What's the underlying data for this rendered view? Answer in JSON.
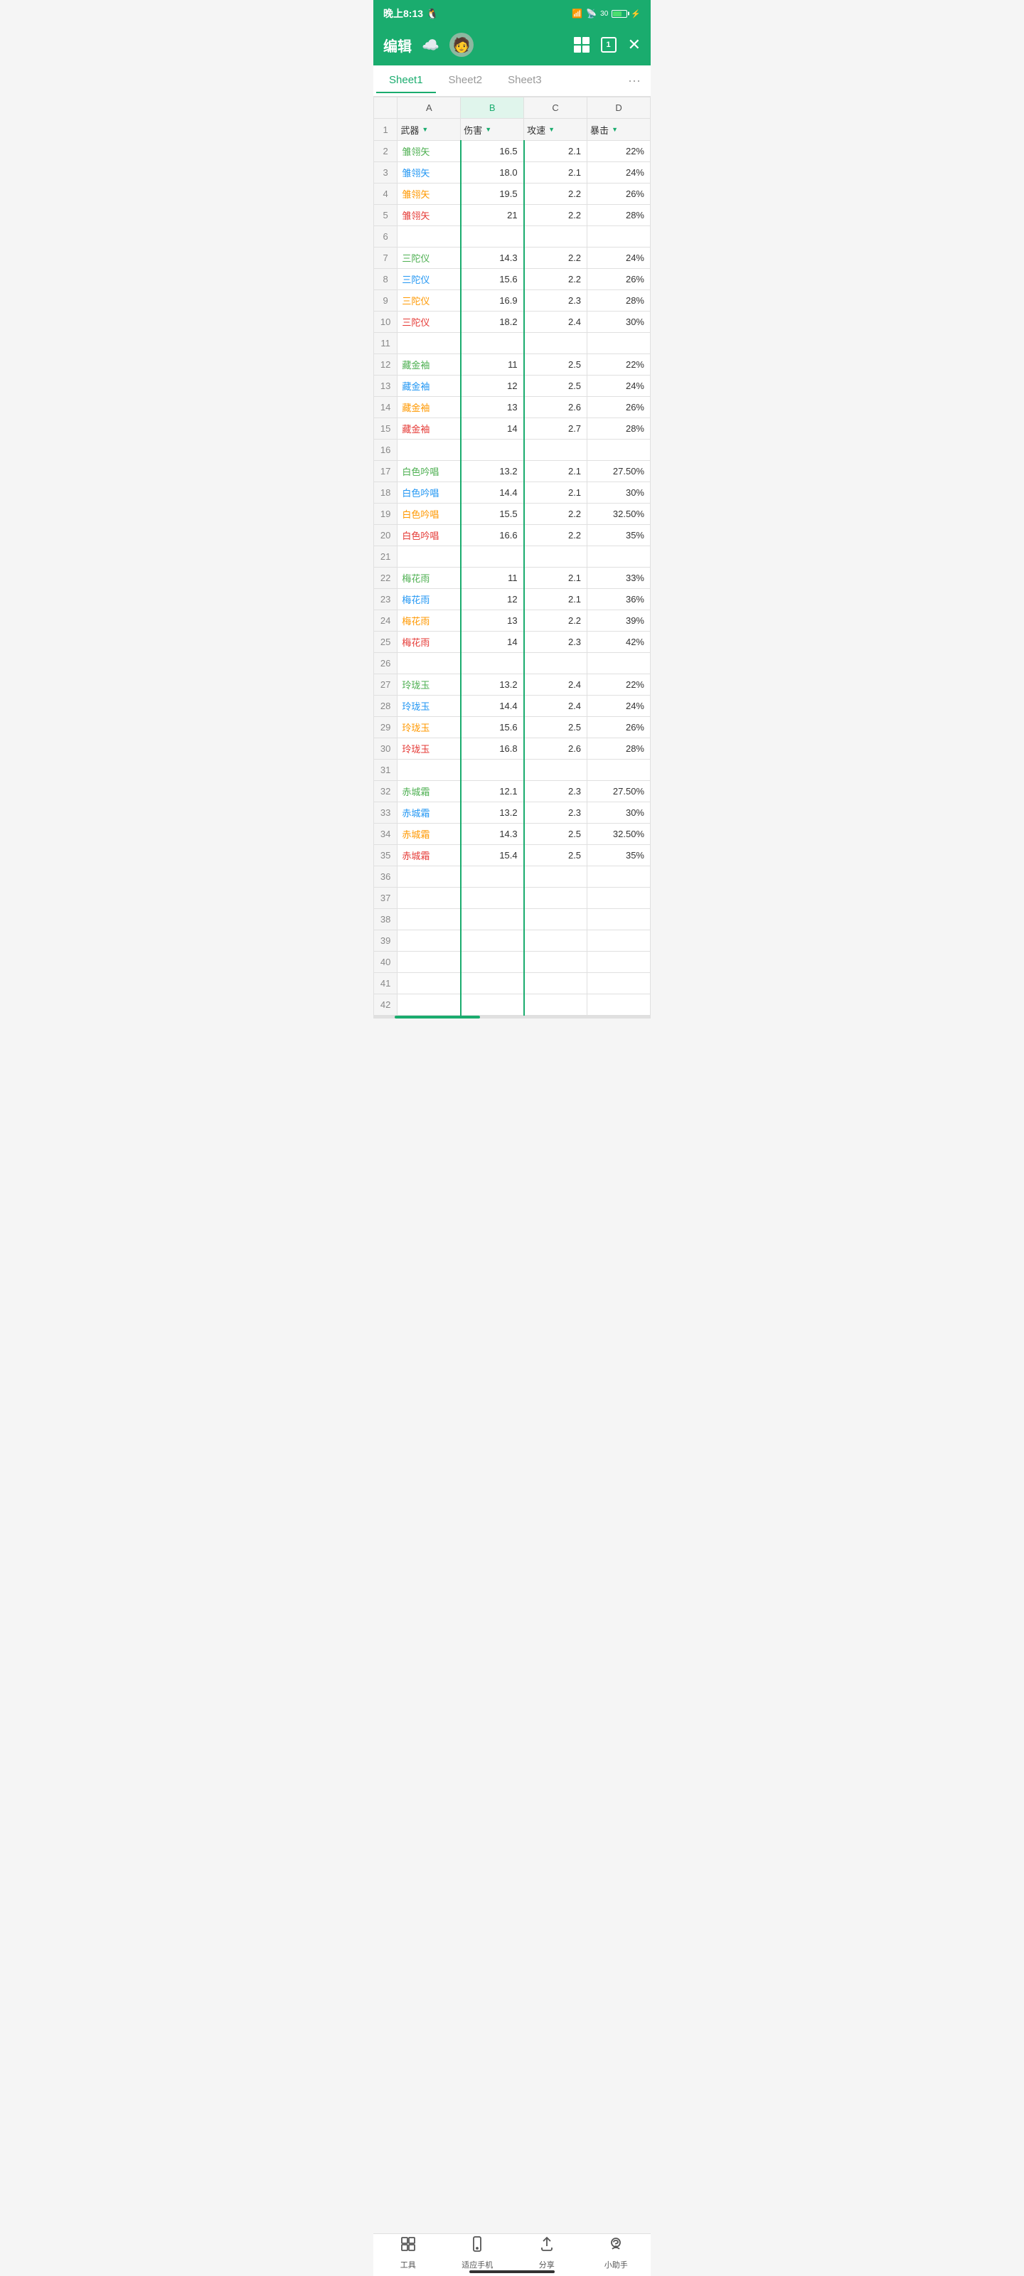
{
  "statusBar": {
    "time": "晚上8:13",
    "penguin_icon": "🐧",
    "battery_level": "30"
  },
  "toolbar": {
    "edit_label": "编辑",
    "grid_icon": "grid-icon",
    "box_icon_label": "1",
    "close_icon": "✕"
  },
  "tabs": [
    {
      "label": "Sheet1",
      "active": true
    },
    {
      "label": "Sheet2",
      "active": false
    },
    {
      "label": "Sheet3",
      "active": false
    }
  ],
  "more_label": "···",
  "columns": [
    "A",
    "B",
    "C",
    "D"
  ],
  "headers": [
    "武器",
    "伤害",
    "攻速",
    "暴击"
  ],
  "rows": [
    {
      "num": 1,
      "a": "武器",
      "b": "伤害",
      "c": "攻速",
      "d": "暴击",
      "type": "header"
    },
    {
      "num": 2,
      "a": "雏翎矢",
      "b": "16.5",
      "c": "2.1",
      "d": "22%",
      "color": "green"
    },
    {
      "num": 3,
      "a": "雏翎矢",
      "b": "18.0",
      "c": "2.1",
      "d": "24%",
      "color": "blue"
    },
    {
      "num": 4,
      "a": "雏翎矢",
      "b": "19.5",
      "c": "2.2",
      "d": "26%",
      "color": "orange"
    },
    {
      "num": 5,
      "a": "雏翎矢",
      "b": "21",
      "c": "2.2",
      "d": "28%",
      "color": "red"
    },
    {
      "num": 6,
      "a": "",
      "b": "",
      "c": "",
      "d": "",
      "color": ""
    },
    {
      "num": 7,
      "a": "三陀仪",
      "b": "14.3",
      "c": "2.2",
      "d": "24%",
      "color": "green"
    },
    {
      "num": 8,
      "a": "三陀仪",
      "b": "15.6",
      "c": "2.2",
      "d": "26%",
      "color": "blue"
    },
    {
      "num": 9,
      "a": "三陀仪",
      "b": "16.9",
      "c": "2.3",
      "d": "28%",
      "color": "orange"
    },
    {
      "num": 10,
      "a": "三陀仪",
      "b": "18.2",
      "c": "2.4",
      "d": "30%",
      "color": "red"
    },
    {
      "num": 11,
      "a": "",
      "b": "",
      "c": "",
      "d": "",
      "color": ""
    },
    {
      "num": 12,
      "a": "藏金袖",
      "b": "11",
      "c": "2.5",
      "d": "22%",
      "color": "green"
    },
    {
      "num": 13,
      "a": "藏金袖",
      "b": "12",
      "c": "2.5",
      "d": "24%",
      "color": "blue"
    },
    {
      "num": 14,
      "a": "藏金袖",
      "b": "13",
      "c": "2.6",
      "d": "26%",
      "color": "orange"
    },
    {
      "num": 15,
      "a": "藏金袖",
      "b": "14",
      "c": "2.7",
      "d": "28%",
      "color": "red"
    },
    {
      "num": 16,
      "a": "",
      "b": "",
      "c": "",
      "d": "",
      "color": ""
    },
    {
      "num": 17,
      "a": "白色吟唱",
      "b": "13.2",
      "c": "2.1",
      "d": "27.50%",
      "color": "green"
    },
    {
      "num": 18,
      "a": "白色吟唱",
      "b": "14.4",
      "c": "2.1",
      "d": "30%",
      "color": "blue"
    },
    {
      "num": 19,
      "a": "白色吟唱",
      "b": "15.5",
      "c": "2.2",
      "d": "32.50%",
      "color": "orange"
    },
    {
      "num": 20,
      "a": "白色吟唱",
      "b": "16.6",
      "c": "2.2",
      "d": "35%",
      "color": "red"
    },
    {
      "num": 21,
      "a": "",
      "b": "",
      "c": "",
      "d": "",
      "color": ""
    },
    {
      "num": 22,
      "a": "梅花雨",
      "b": "11",
      "c": "2.1",
      "d": "33%",
      "color": "green"
    },
    {
      "num": 23,
      "a": "梅花雨",
      "b": "12",
      "c": "2.1",
      "d": "36%",
      "color": "blue"
    },
    {
      "num": 24,
      "a": "梅花雨",
      "b": "13",
      "c": "2.2",
      "d": "39%",
      "color": "orange"
    },
    {
      "num": 25,
      "a": "梅花雨",
      "b": "14",
      "c": "2.3",
      "d": "42%",
      "color": "red"
    },
    {
      "num": 26,
      "a": "",
      "b": "",
      "c": "",
      "d": "",
      "color": ""
    },
    {
      "num": 27,
      "a": "玲珑玉",
      "b": "13.2",
      "c": "2.4",
      "d": "22%",
      "color": "green"
    },
    {
      "num": 28,
      "a": "玲珑玉",
      "b": "14.4",
      "c": "2.4",
      "d": "24%",
      "color": "blue"
    },
    {
      "num": 29,
      "a": "玲珑玉",
      "b": "15.6",
      "c": "2.5",
      "d": "26%",
      "color": "orange"
    },
    {
      "num": 30,
      "a": "玲珑玉",
      "b": "16.8",
      "c": "2.6",
      "d": "28%",
      "color": "red"
    },
    {
      "num": 31,
      "a": "",
      "b": "",
      "c": "",
      "d": "",
      "color": ""
    },
    {
      "num": 32,
      "a": "赤城霜",
      "b": "12.1",
      "c": "2.3",
      "d": "27.50%",
      "color": "green"
    },
    {
      "num": 33,
      "a": "赤城霜",
      "b": "13.2",
      "c": "2.3",
      "d": "30%",
      "color": "blue"
    },
    {
      "num": 34,
      "a": "赤城霜",
      "b": "14.3",
      "c": "2.5",
      "d": "32.50%",
      "color": "orange"
    },
    {
      "num": 35,
      "a": "赤城霜",
      "b": "15.4",
      "c": "2.5",
      "d": "35%",
      "color": "red"
    },
    {
      "num": 36,
      "a": "",
      "b": "",
      "c": "",
      "d": "",
      "color": ""
    },
    {
      "num": 37,
      "a": "",
      "b": "",
      "c": "",
      "d": "",
      "color": ""
    },
    {
      "num": 38,
      "a": "",
      "b": "",
      "c": "",
      "d": "",
      "color": ""
    },
    {
      "num": 39,
      "a": "",
      "b": "",
      "c": "",
      "d": "",
      "color": ""
    },
    {
      "num": 40,
      "a": "",
      "b": "",
      "c": "",
      "d": "",
      "color": ""
    },
    {
      "num": 41,
      "a": "",
      "b": "",
      "c": "",
      "d": "",
      "color": ""
    },
    {
      "num": 42,
      "a": "",
      "b": "",
      "c": "",
      "d": "",
      "color": ""
    }
  ],
  "bottomNav": [
    {
      "icon": "⊞",
      "label": "工具"
    },
    {
      "icon": "📱",
      "label": "适应手机"
    },
    {
      "icon": "↑",
      "label": "分享"
    },
    {
      "icon": "🤖",
      "label": "小助手"
    }
  ]
}
